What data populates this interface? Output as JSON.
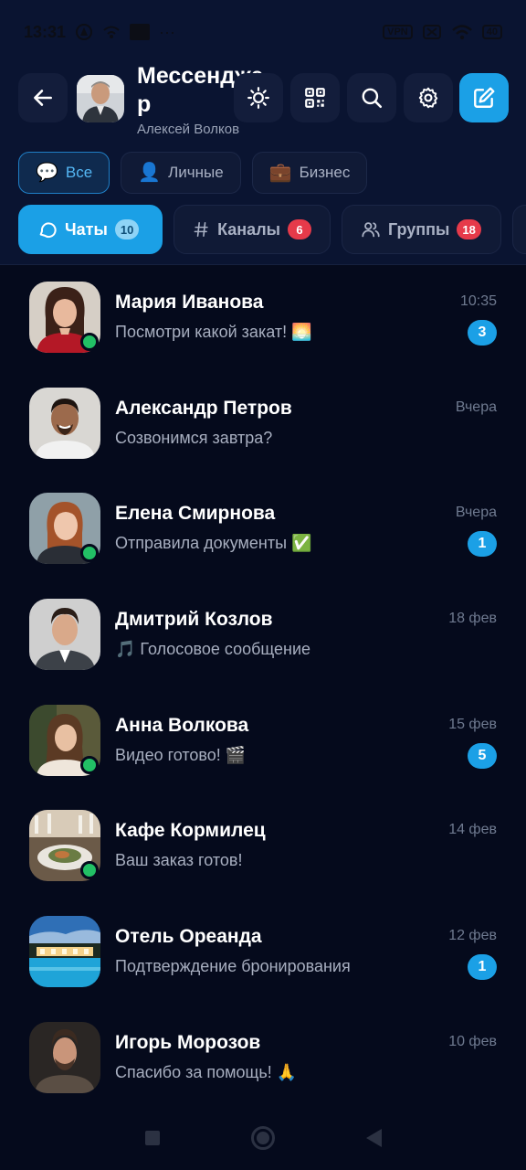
{
  "status_bar": {
    "time": "13:31",
    "vpn": "VPN",
    "battery": "40",
    "dots": "···"
  },
  "header": {
    "title": "Мессенджер",
    "subtitle": "Алексей Волков",
    "buttons": [
      "back",
      "theme",
      "qr",
      "search",
      "settings",
      "compose"
    ]
  },
  "filters": [
    {
      "label": "Все",
      "icon": "💬",
      "active": true
    },
    {
      "label": "Личные",
      "icon": "👤",
      "active": false
    },
    {
      "label": "Бизнес",
      "icon": "💼",
      "active": false
    }
  ],
  "tabs": [
    {
      "label": "Чаты",
      "count": "10",
      "active": true
    },
    {
      "label": "Каналы",
      "count": "6",
      "active": false
    },
    {
      "label": "Группы",
      "count": "18",
      "active": false
    }
  ],
  "chats": [
    {
      "name": "Мария Иванова",
      "preview": "Посмотри какой закат! 🌅",
      "time": "10:35",
      "unread": "3",
      "online": true
    },
    {
      "name": "Александр Петров",
      "preview": "Созвонимся завтра?",
      "time": "Вчера",
      "unread": "",
      "online": false
    },
    {
      "name": "Елена Смирнова",
      "preview": "Отправила документы ✅",
      "time": "Вчера",
      "unread": "1",
      "online": true
    },
    {
      "name": "Дмитрий Козлов",
      "preview": "🎵 Голосовое сообщение",
      "time": "18 фев",
      "unread": "",
      "online": false
    },
    {
      "name": "Анна Волкова",
      "preview": "Видео готово! 🎬",
      "time": "15 фев",
      "unread": "5",
      "online": true
    },
    {
      "name": "Кафе Кормилец",
      "preview": "Ваш заказ готов!",
      "time": "14 фев",
      "unread": "",
      "online": true
    },
    {
      "name": "Отель Ореанда",
      "preview": "Подтверждение бронирования",
      "time": "12 фев",
      "unread": "1",
      "online": false
    },
    {
      "name": "Игорь Морозов",
      "preview": "Спасибо за помощь! 🙏",
      "time": "10 фев",
      "unread": "",
      "online": false
    }
  ],
  "colors": {
    "accent": "#1ba0e6",
    "background": "#050a1c",
    "header": "#0a1431",
    "online": "#22c065",
    "badge_red": "#e63a4a"
  }
}
